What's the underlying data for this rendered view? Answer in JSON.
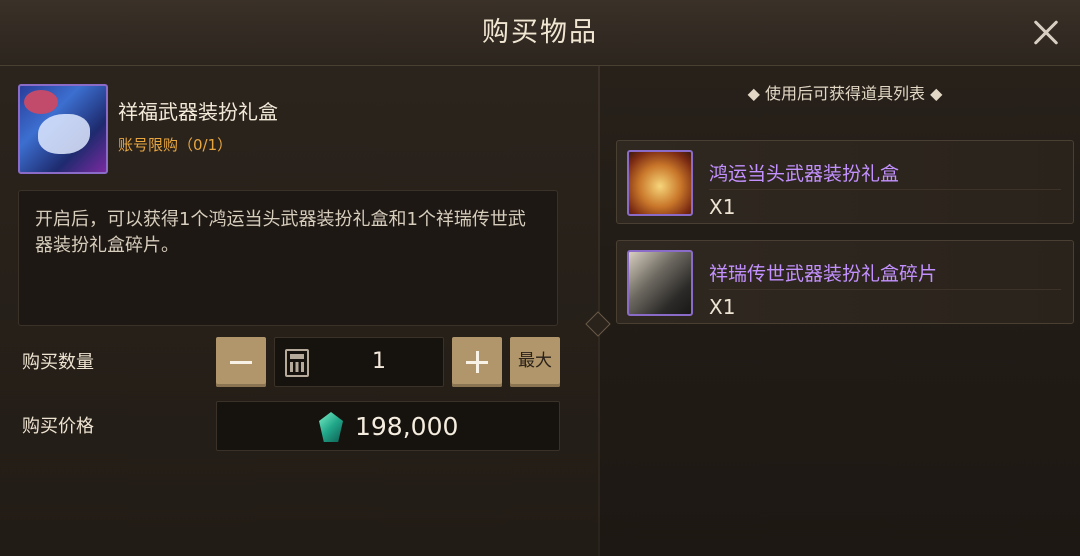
{
  "header": {
    "title": "购买物品"
  },
  "item": {
    "name": "祥福武器装扮礼盒",
    "limit": "账号限购（0/1）",
    "description": "开启后，可以获得1个鸿运当头武器装扮礼盒和1个祥瑞传世武器装扮礼盒碎片。"
  },
  "purchase": {
    "quantity_label": "购买数量",
    "quantity_value": "1",
    "max_label": "最大",
    "price_label": "购买价格",
    "price_value": "198,000"
  },
  "rewards": {
    "title": "◆ 使用后可获得道具列表 ◆",
    "items": [
      {
        "name": "鸿运当头武器装扮礼盒",
        "qty": "X1"
      },
      {
        "name": "祥瑞传世武器装扮礼盒碎片",
        "qty": "X1"
      }
    ]
  },
  "colors": {
    "accent_gold": "#b0966a",
    "limit_orange": "#e7a640",
    "reward_purple": "#c391ff",
    "icon_frame_purple": "#8a6cc8"
  },
  "icons": [
    "close-icon",
    "calculator-icon",
    "gem-currency-icon"
  ]
}
